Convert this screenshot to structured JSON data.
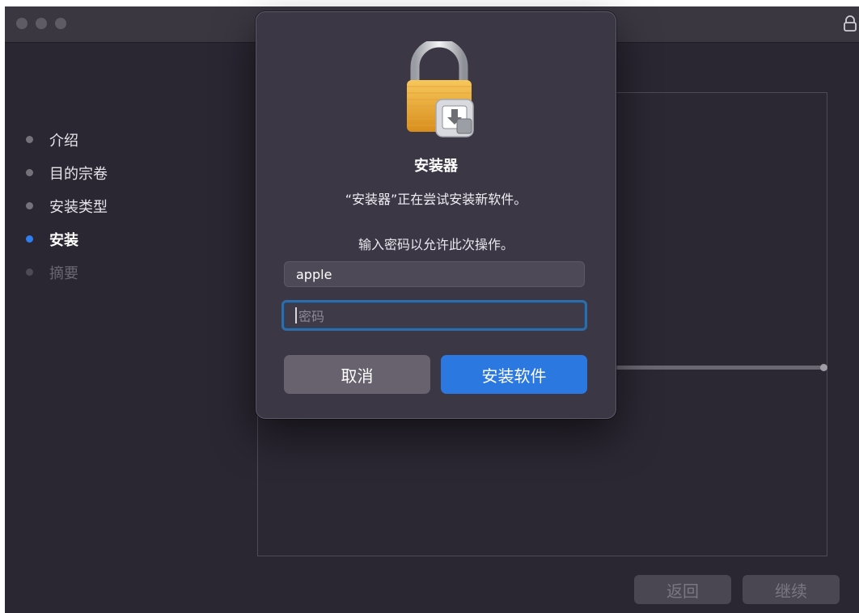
{
  "sidebar": {
    "steps": [
      {
        "label": "介绍",
        "state": "done"
      },
      {
        "label": "目的宗卷",
        "state": "done"
      },
      {
        "label": "安装类型",
        "state": "done"
      },
      {
        "label": "安装",
        "state": "active"
      },
      {
        "label": "摘要",
        "state": "disabled"
      }
    ]
  },
  "footer": {
    "back_label": "返回",
    "continue_label": "继续"
  },
  "dialog": {
    "icon": "lock-installer-icon",
    "title": "安装器",
    "message": "“安装器”正在尝试安装新软件。",
    "prompt": "输入密码以允许此次操作。",
    "username_value": "apple",
    "password_placeholder": "密码",
    "cancel_label": "取消",
    "install_label": "安装软件"
  },
  "colors": {
    "window_bg": "#2a2632",
    "dialog_bg": "#3c3744",
    "accent": "#2b78e0",
    "active_step": "#2f7ef1"
  }
}
